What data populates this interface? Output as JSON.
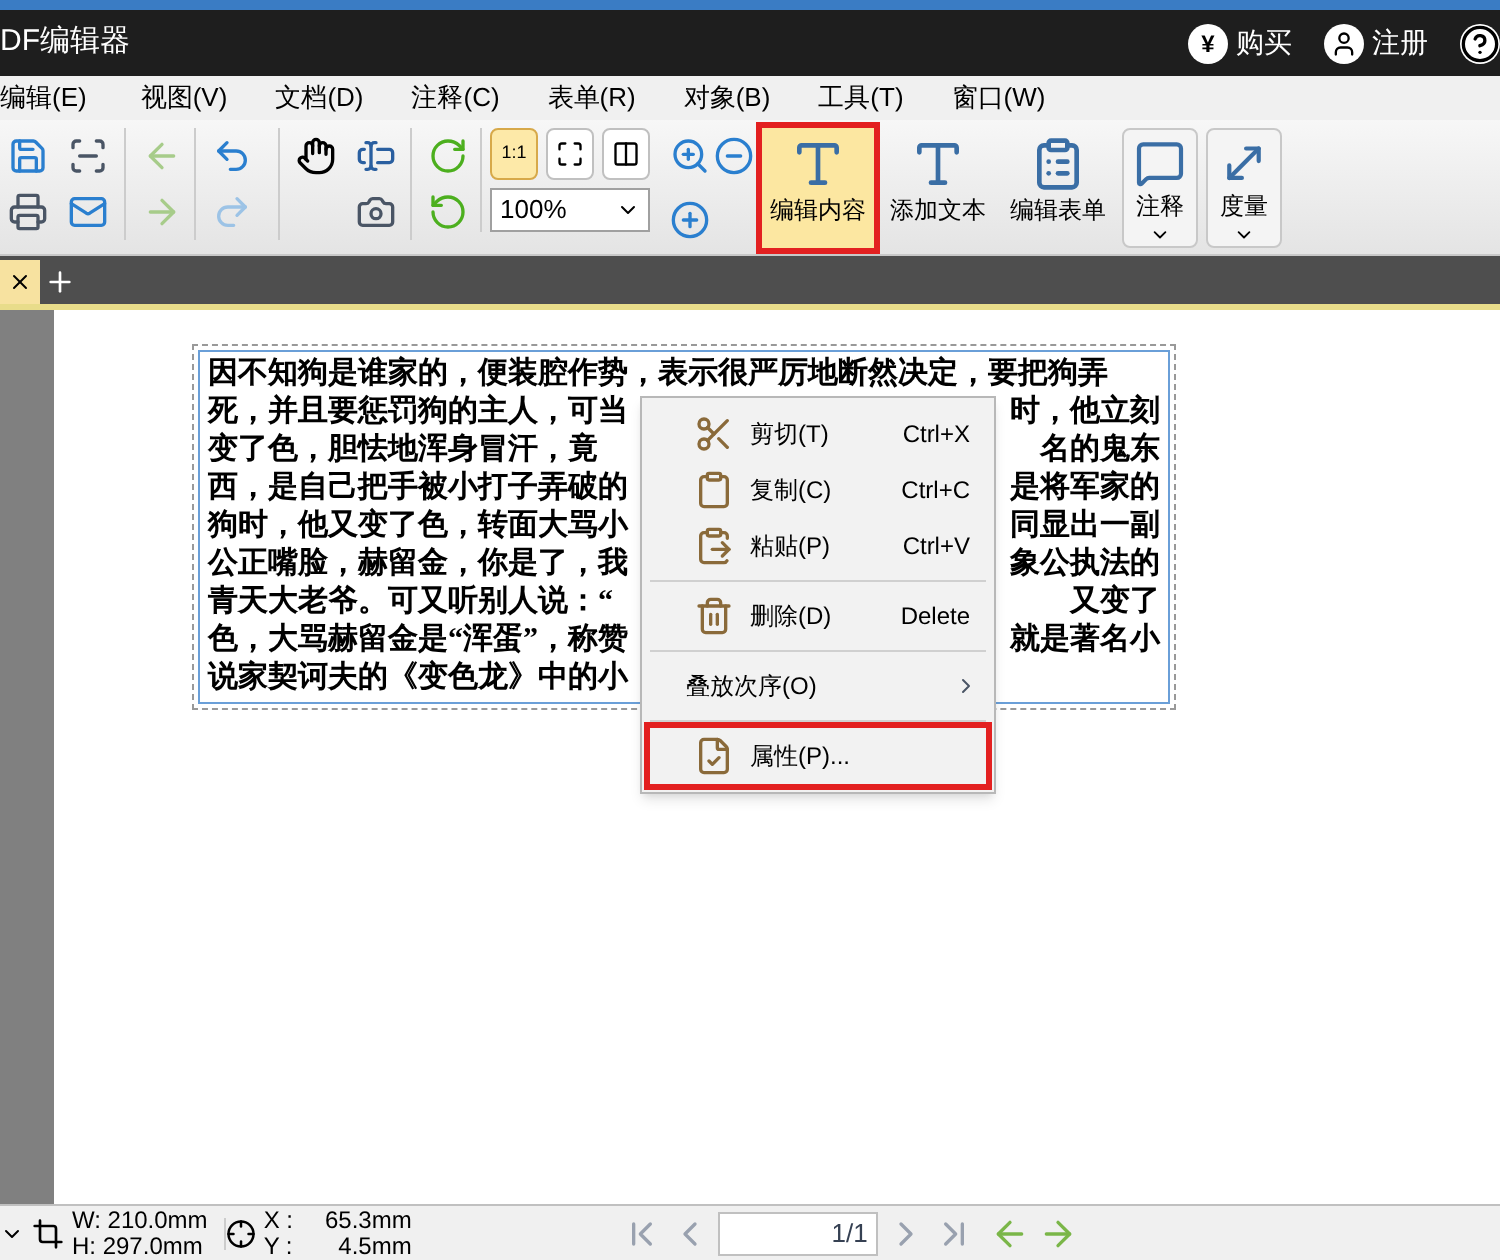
{
  "window": {
    "title": "DF编辑器",
    "actions": [
      {
        "kind": "buy",
        "symbol": "¥",
        "label": "购买"
      },
      {
        "kind": "register",
        "label": "注册"
      }
    ]
  },
  "menu_bar": [
    "编辑(E)",
    "视图(V)",
    "文档(D)",
    "注释(C)",
    "表单(R)",
    "对象(B)",
    "工具(T)",
    "窗口(W)"
  ],
  "toolbar": {
    "page_fit": [
      {
        "kind": "actual",
        "label": "1:1",
        "selected": true
      },
      {
        "kind": "fit",
        "selected": false
      },
      {
        "kind": "width",
        "selected": false
      }
    ],
    "zoom": "100%",
    "tools": [
      {
        "kind": "edit-content",
        "label": "编辑内容",
        "selected": true,
        "dropdown": false
      },
      {
        "kind": "add-text",
        "label": "添加文本",
        "selected": false,
        "dropdown": false
      },
      {
        "kind": "edit-form",
        "label": "编辑表单",
        "selected": false,
        "dropdown": false
      },
      {
        "kind": "comment",
        "label": "注释",
        "selected": false,
        "dropdown": true
      },
      {
        "kind": "measure",
        "label": "度量",
        "selected": false,
        "dropdown": true
      }
    ]
  },
  "document": {
    "lines": [
      {
        "left": "因不知狗是谁家的，便装腔作势，表示很严厉地断然决定，要把狗弄"
      },
      {
        "left": "死，并且要惩罚狗的主人，可当",
        "right": "时，他立刻"
      },
      {
        "left": "变了色，胆怯地浑身冒汗，竟",
        "right": "名的鬼东"
      },
      {
        "left": "西，是自己把手被小打子弄破的",
        "right": "是将军家的"
      },
      {
        "left": "狗时，他又变了色，转面大骂小",
        "right": "同显出一副"
      },
      {
        "left": "公正嘴脸，赫留金，你是了，我",
        "right": "象公执法的"
      },
      {
        "left": "青天大老爷。可又听别人说：“",
        "right": "又变了"
      },
      {
        "left": "色，大骂赫留金是“浑蛋”，称赞",
        "right": "就是著名小"
      },
      {
        "left": "说家契诃夫的《变色龙》中的小"
      }
    ]
  },
  "context_menu": [
    {
      "kind": "cut",
      "label": "剪切(T)",
      "shortcut": "Ctrl+X",
      "selected": false
    },
    {
      "kind": "copy",
      "label": "复制(C)",
      "shortcut": "Ctrl+C",
      "selected": false
    },
    {
      "kind": "paste",
      "label": "粘贴(P)",
      "shortcut": "Ctrl+V",
      "selected": false
    },
    {
      "kind": "separator"
    },
    {
      "kind": "delete",
      "label": "删除(D)",
      "shortcut": "Delete",
      "selected": false
    },
    {
      "kind": "separator"
    },
    {
      "kind": "submenu",
      "label": "叠放次序(O)",
      "selected": false
    },
    {
      "kind": "separator"
    },
    {
      "kind": "properties",
      "label": "属性(P)...",
      "selected": true
    }
  ],
  "status_bar": {
    "w": "W: 210.0mm",
    "h": "H: 297.0mm",
    "x_label": "X :",
    "x_value": "65.3mm",
    "y_label": "Y :",
    "y_value": "4.5mm",
    "page": "1/1"
  }
}
